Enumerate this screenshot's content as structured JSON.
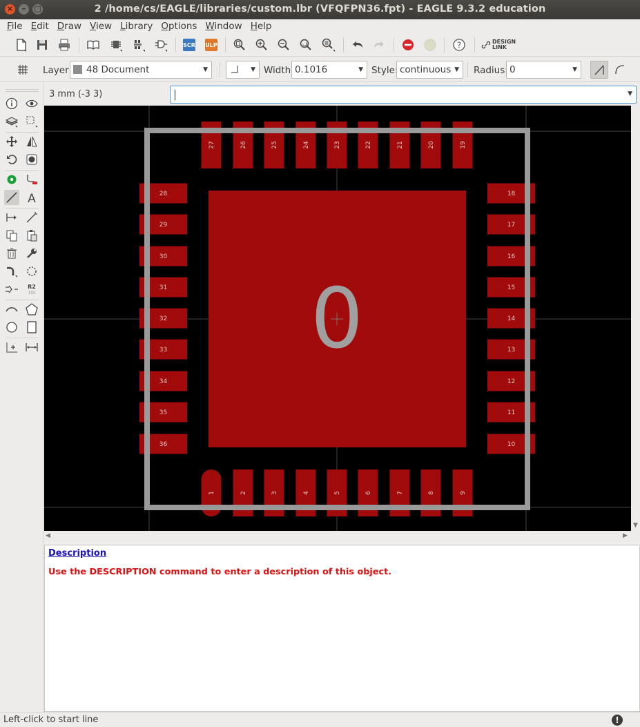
{
  "window": {
    "title": "2 /home/cs/EAGLE/libraries/custom.lbr (VFQFPN36.fpt) - EAGLE 9.3.2 education"
  },
  "menubar": [
    {
      "label": "File",
      "mnemonic": "F",
      "rest": "ile"
    },
    {
      "label": "Edit",
      "mnemonic": "E",
      "rest": "dit"
    },
    {
      "label": "Draw",
      "mnemonic": "D",
      "rest": "raw"
    },
    {
      "label": "View",
      "mnemonic": "V",
      "rest": "iew"
    },
    {
      "label": "Library",
      "mnemonic": "L",
      "rest": "ibrary"
    },
    {
      "label": "Options",
      "mnemonic": "O",
      "rest": "ptions"
    },
    {
      "label": "Window",
      "mnemonic": "W",
      "rest": "indow"
    },
    {
      "label": "Help",
      "mnemonic": "H",
      "rest": "elp"
    }
  ],
  "toolbar": {
    "scr_label": "SCR",
    "ulp_label": "ULP",
    "design_link_line1": "DESIGN",
    "design_link_line2": "LINK"
  },
  "params": {
    "layer_label": "Layer:",
    "layer_value": "48 Document",
    "layer_color": "#8c8c8c",
    "width_label": "Width:",
    "width_value": "0.1016",
    "style_label": "Style:",
    "style_value": "continuous",
    "radius_label": "Radius:",
    "radius_value": "0"
  },
  "coordinate_readout": "3 mm (-3 3)",
  "command_line": {
    "value": ""
  },
  "footprint": {
    "name_text": "0",
    "pad_color": "#a10b0b",
    "outline_color": "#9a9a9a",
    "pads_top": [
      "27",
      "26",
      "25",
      "24",
      "23",
      "22",
      "21",
      "20",
      "19"
    ],
    "pads_bottom": [
      "1",
      "2",
      "3",
      "4",
      "5",
      "6",
      "7",
      "8",
      "9"
    ],
    "pads_left": [
      "28",
      "29",
      "30",
      "31",
      "32",
      "33",
      "34",
      "35",
      "36"
    ],
    "pads_right": [
      "18",
      "17",
      "16",
      "15",
      "14",
      "13",
      "12",
      "11",
      "10"
    ]
  },
  "description": {
    "link": "Description",
    "text": "Use the DESCRIPTION command to enter a description of this object."
  },
  "status": {
    "text": "Left-click to start line"
  },
  "left_tools": [
    "info-icon",
    "show-icon",
    "display-layers-icon",
    "mark-icon",
    "move-icon",
    "mirror-icon",
    "rotate-icon",
    "group-icon",
    "pad-icon",
    "smd-icon",
    "line-icon",
    "text-icon",
    "copy-icon",
    "split-icon",
    "delete-icon",
    "change-icon",
    "paste-icon",
    "name-icon",
    "value-icon",
    "arc-icon",
    "polygon-icon",
    "circle-icon",
    "rect-icon",
    "mark-origin-icon",
    "dimension-icon"
  ]
}
